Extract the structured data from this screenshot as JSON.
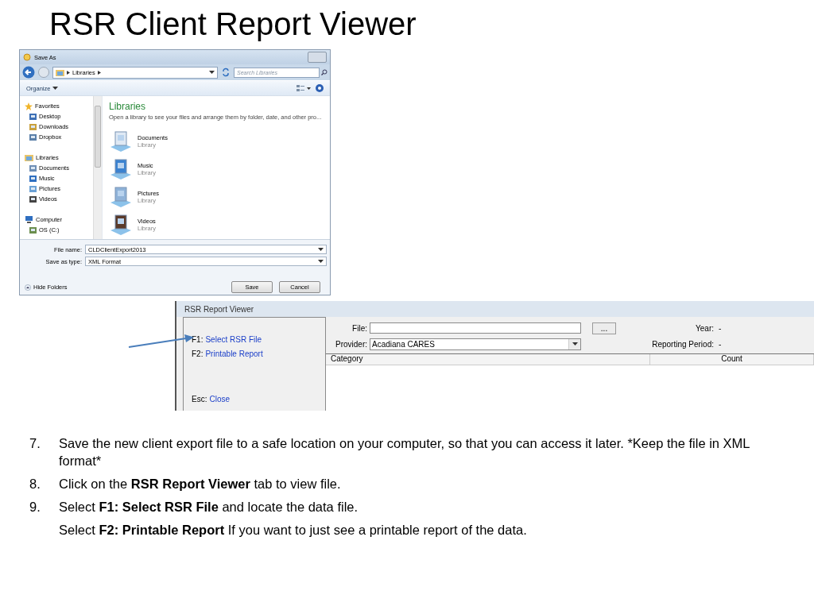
{
  "slide": {
    "title": "RSR Client Report Viewer"
  },
  "save_dialog": {
    "title": "Save As",
    "breadcrumb": [
      "Libraries"
    ],
    "search": {
      "placeholder": "Search Libraries"
    },
    "organize": "Organize",
    "nav": [
      {
        "label": "Favorites",
        "children": [
          {
            "label": "Desktop"
          },
          {
            "label": "Downloads"
          },
          {
            "label": "Dropbox"
          }
        ]
      },
      {
        "label": "Libraries",
        "children": [
          {
            "label": "Documents"
          },
          {
            "label": "Music"
          },
          {
            "label": "Pictures"
          },
          {
            "label": "Videos"
          }
        ]
      },
      {
        "label": "Computer",
        "children": [
          {
            "label": "OS (C:)"
          }
        ]
      }
    ],
    "content": {
      "heading": "Libraries",
      "description": "Open a library to see your files and arrange them by folder, date, and other pro...",
      "libraries": [
        {
          "name": "Documents",
          "type": "Library"
        },
        {
          "name": "Music",
          "type": "Library"
        },
        {
          "name": "Pictures",
          "type": "Library"
        },
        {
          "name": "Videos",
          "type": "Library"
        }
      ]
    },
    "file_name": {
      "label": "File name:",
      "value": "CLDClientExport2013"
    },
    "save_type": {
      "label": "Save as type:",
      "value": "XML Format"
    },
    "hide_folders": "Hide Folders",
    "buttons": [
      "Save",
      "Cancel"
    ]
  },
  "report_viewer": {
    "title": "RSR Report Viewer",
    "commands": [
      {
        "key": "F1:",
        "action": "Select RSR File"
      },
      {
        "key": "F2:",
        "action": "Printable Report"
      },
      {
        "key": "Esc:",
        "action": "Close"
      }
    ],
    "file": {
      "label": "File:"
    },
    "browse": "...",
    "provider": {
      "label": "Provider:",
      "value": "Acadiana CARES"
    },
    "year": {
      "label": "Year:",
      "value": "-"
    },
    "period": {
      "label": "Reporting Period:",
      "value": "-"
    },
    "table": {
      "columns": [
        "Category",
        "Count"
      ]
    }
  },
  "steps": [
    {
      "number": "7.",
      "segments": [
        {
          "text": "Save the new client export file to a safe location on your computer, so that you can access it later. *Keep the file in XML format*",
          "bold": false
        }
      ]
    },
    {
      "number": "8.",
      "segments": [
        {
          "text": "Click on the ",
          "bold": false
        },
        {
          "text": "RSR Report Viewer",
          "bold": true
        },
        {
          "text": " tab to view file.",
          "bold": false
        }
      ]
    },
    {
      "number": "9.",
      "segments": [
        {
          "text": "Select ",
          "bold": false
        },
        {
          "text": "F1: Select RSR File",
          "bold": true
        },
        {
          "text": " and locate the data file.",
          "bold": false
        }
      ]
    },
    {
      "segments": [
        {
          "text": "Select ",
          "bold": false
        },
        {
          "text": "F2: Printable Report",
          "bold": true
        },
        {
          "text": " If you want to just see a printable report of the data.",
          "bold": false
        }
      ]
    }
  ]
}
